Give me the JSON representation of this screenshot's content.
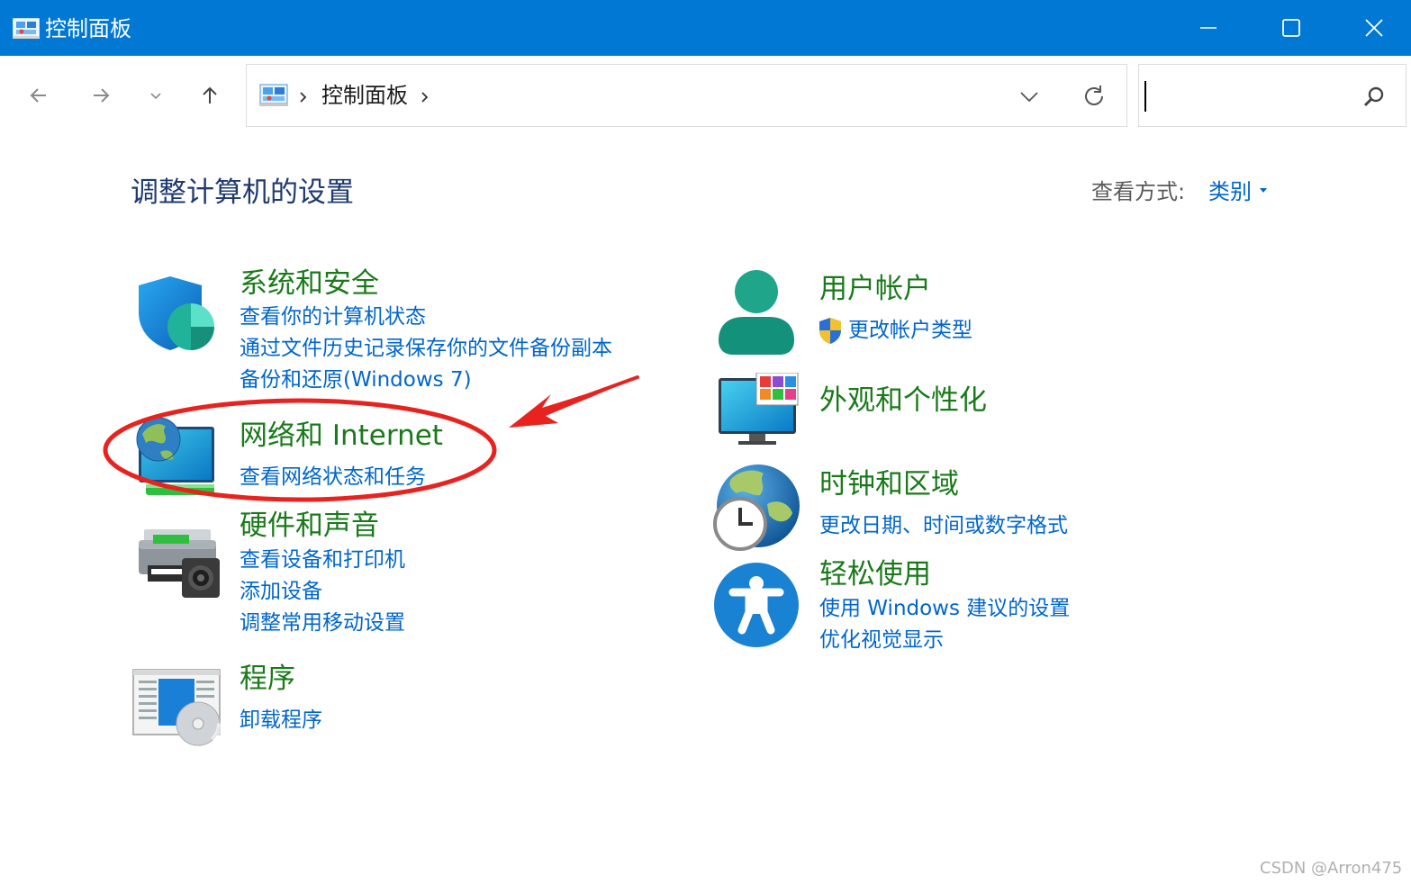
{
  "window": {
    "title": "控制面板",
    "icon": "control-panel-icon",
    "controls": [
      "minimize-icon",
      "maximize-icon",
      "close-icon"
    ]
  },
  "nav": {
    "back_icon": "arrow-left-icon",
    "forward_icon": "arrow-right-icon",
    "recent_icon": "chevron-down-icon",
    "up_icon": "arrow-up-icon",
    "breadcrumb": [
      "控制面板"
    ],
    "refresh_icon": "refresh-icon",
    "search_value": "",
    "search_icon": "search-icon"
  },
  "main": {
    "heading": "调整计算机的设置",
    "view_by_label": "查看方式:",
    "view_by_value": "类别"
  },
  "categories": [
    {
      "title": "系统和安全",
      "icon": "shield-icon",
      "links": [
        "查看你的计算机状态",
        "通过文件历史记录保存你的文件备份副本",
        "备份和还原(Windows 7)"
      ]
    },
    {
      "title": "网络和 Internet",
      "icon": "network-globe-icon",
      "links": [
        "查看网络状态和任务"
      ]
    },
    {
      "title": "硬件和声音",
      "icon": "printer-icon",
      "links": [
        "查看设备和打印机",
        "添加设备",
        "调整常用移动设置"
      ]
    },
    {
      "title": "程序",
      "icon": "programs-icon",
      "links": [
        "卸载程序"
      ]
    },
    {
      "title": "用户帐户",
      "icon": "user-icon",
      "links": [
        "更改帐户类型"
      ]
    },
    {
      "title": "外观和个性化",
      "icon": "monitor-palette-icon",
      "links": []
    },
    {
      "title": "时钟和区域",
      "icon": "clock-globe-icon",
      "links": [
        "更改日期、时间或数字格式"
      ]
    },
    {
      "title": "轻松使用",
      "icon": "accessibility-icon",
      "links": [
        "使用 Windows 建议的设置",
        "优化视觉显示"
      ]
    }
  ],
  "annotation": {
    "color": "#e8231f",
    "shapes": [
      "ellipse-highlight",
      "arrow"
    ]
  },
  "watermark": "CSDN @Arron475",
  "colors": {
    "titlebar": "#0078d4",
    "category_title": "#1a7a1a",
    "link": "#0066cc",
    "heading": "#1e3a6e"
  }
}
